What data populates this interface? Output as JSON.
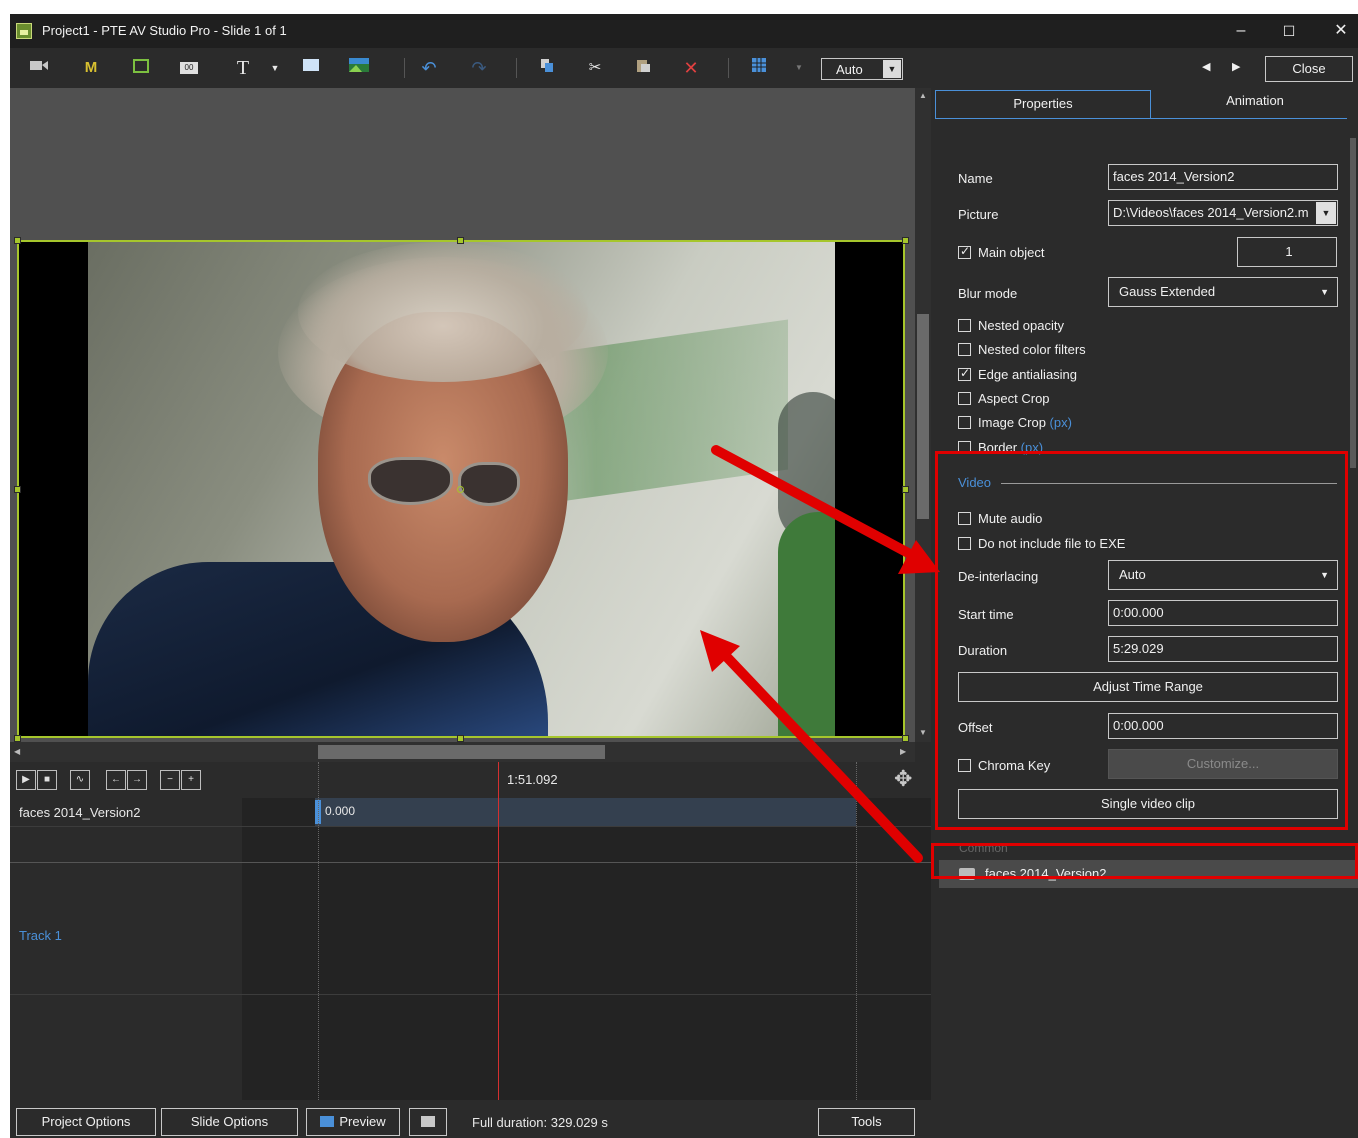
{
  "window": {
    "title": "Project1 - PTE AV Studio Pro - Slide 1 of 1",
    "minimize": "–",
    "maximize": "☐",
    "close": "✕"
  },
  "toolbar": {
    "zoom_value": "Auto",
    "close_label": "Close",
    "icons": [
      "video-icon",
      "mask-icon",
      "frame-icon",
      "counter-icon",
      "text-icon",
      "rectangle-icon",
      "image-icon",
      "undo-icon",
      "redo-icon",
      "copy-icon",
      "cut-icon",
      "paste-icon",
      "delete-icon",
      "grid-icon"
    ],
    "mask_glyph": "M",
    "text_glyph": "T",
    "counter_glyph": "00"
  },
  "tabs": {
    "properties": "Properties",
    "animation": "Animation"
  },
  "properties": {
    "name_label": "Name",
    "name_value": "faces 2014_Version2",
    "picture_label": "Picture",
    "picture_value": "D:\\Videos\\faces 2014_Version2.m",
    "main_object_label": "Main object",
    "main_object_checked": true,
    "main_object_value": "1",
    "blur_mode_label": "Blur mode",
    "blur_mode_value": "Gauss Extended",
    "nested_opacity": "Nested opacity",
    "nested_color_filters": "Nested color filters",
    "edge_antialiasing": "Edge antialiasing",
    "aspect_crop": "Aspect Crop",
    "image_crop": "Image Crop",
    "border": "Border",
    "px_suffix": "(px)"
  },
  "video": {
    "section_title": "Video",
    "mute_audio": "Mute audio",
    "do_not_include": "Do not include file to EXE",
    "deinterlacing_label": "De-interlacing",
    "deinterlacing_value": "Auto",
    "start_time_label": "Start time",
    "start_time_value": "0:00.000",
    "duration_label": "Duration",
    "duration_value": "5:29.029",
    "adjust_time_range": "Adjust Time Range",
    "offset_label": "Offset",
    "offset_value": "0:00.000",
    "chroma_key": "Chroma Key",
    "customize": "Customize...",
    "single_video_clip": "Single video clip"
  },
  "objects": {
    "caption": "Common",
    "items": [
      "faces 2014_Version2"
    ]
  },
  "timeline": {
    "current_time": "1:51.092",
    "object_label": "faces 2014_Version2",
    "clip_start": "0.000",
    "track_label": "Track 1"
  },
  "bottom": {
    "project_options": "Project Options",
    "slide_options": "Slide Options",
    "preview": "Preview",
    "full_duration": "Full duration: 329.029 s",
    "tools": "Tools"
  },
  "colors": {
    "selection_frame": "#a6c62c",
    "annotation_red": "#e00000",
    "accent_blue": "#4a90d9"
  }
}
